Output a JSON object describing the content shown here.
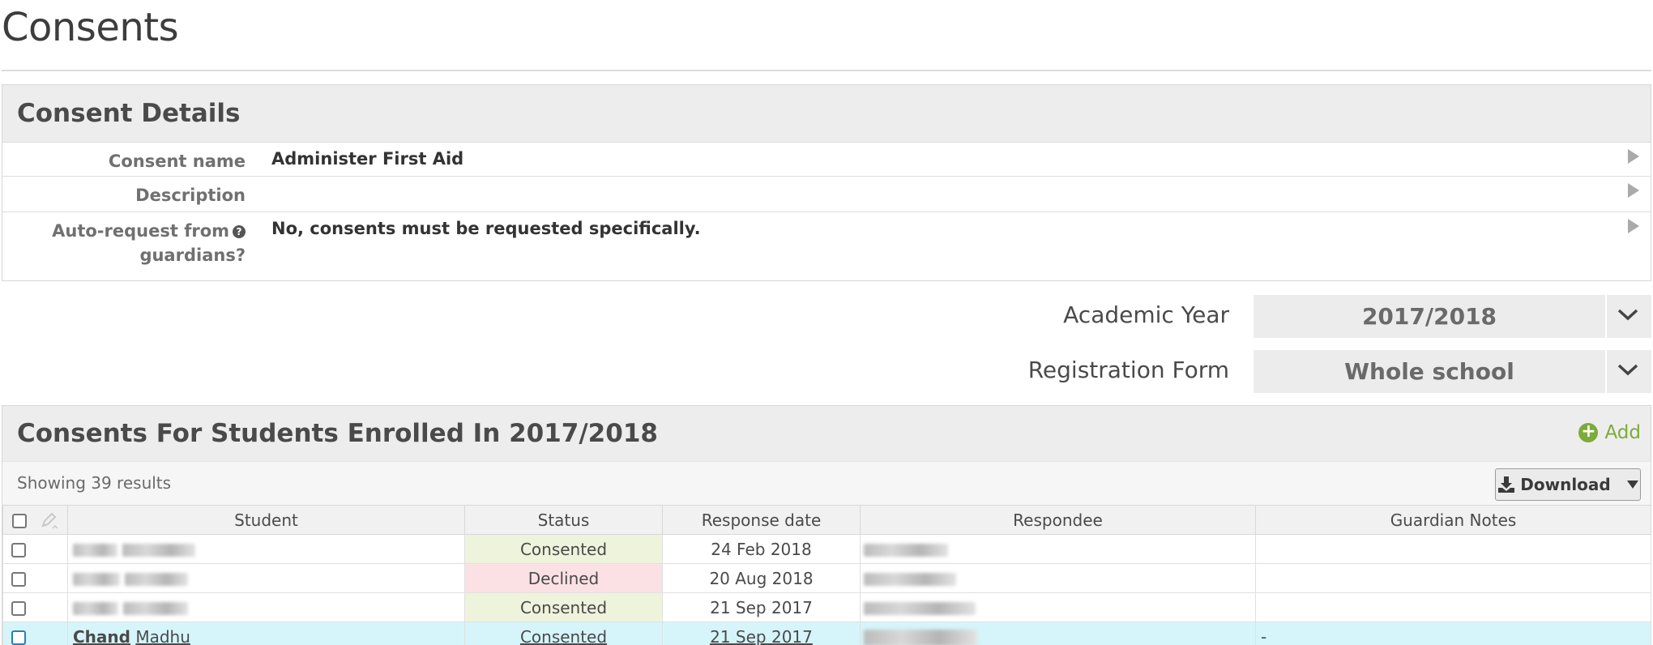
{
  "page": {
    "title": "Consents"
  },
  "details": {
    "heading": "Consent Details",
    "rows": [
      {
        "label": "Consent name",
        "value": "Administer First Aid"
      },
      {
        "label": "Description",
        "value": ""
      },
      {
        "label_line1": "Auto-request from",
        "label_line2": "guardians?",
        "value": "No, consents must be requested specifically."
      }
    ]
  },
  "filters": {
    "academic_year": {
      "label": "Academic Year",
      "value": "2017/2018"
    },
    "registration_form": {
      "label": "Registration Form",
      "value": "Whole school"
    }
  },
  "list": {
    "heading": "Consents For Students Enrolled In 2017/2018",
    "add_label": "Add",
    "results_text": "Showing 39 results",
    "download_label": "Download",
    "columns": [
      "Student",
      "Status",
      "Response date",
      "Respondee",
      "Guardian Notes"
    ],
    "rows": [
      {
        "status": "Consented",
        "date": "24 Feb 2018",
        "notes": ""
      },
      {
        "status": "Declined",
        "date": "20 Aug 2018",
        "notes": ""
      },
      {
        "status": "Consented",
        "date": "21 Sep 2017",
        "notes": ""
      },
      {
        "student_last": "Chand",
        "student_first": "Madhu",
        "status": "Consented",
        "date": "21 Sep 2017",
        "notes": "-"
      }
    ]
  },
  "colors": {
    "consented": "#7ea53a",
    "declined": "#a73b3e",
    "accent_green": "#7cab3a",
    "highlight_row": "#d6f5fa"
  }
}
